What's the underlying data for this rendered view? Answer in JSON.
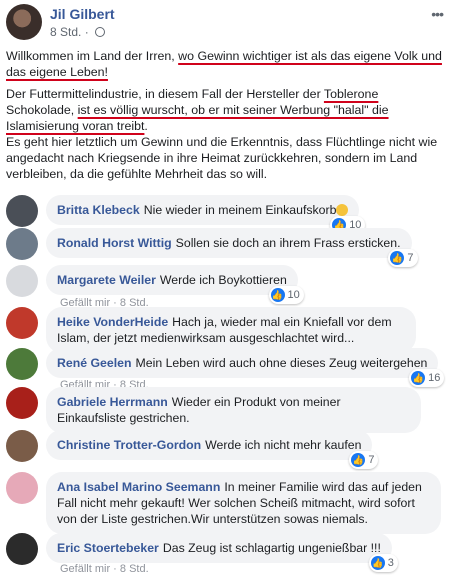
{
  "post": {
    "author": "Jil Gilbert",
    "time": "8 Std.",
    "menu_label": "•••",
    "p1_a": "Willkommen im Land der Irren, ",
    "p1_b": "wo Gewinn wichtiger ist als das eigene Volk und das eigene Leben!",
    "p2_a": "Der Futtermittelindustrie, in diesem Fall der Hersteller der ",
    "p2_b": "Toblerone",
    "p2_c": " Schokolade, ",
    "p2_d": "ist es völlig wurscht, ob er mit seiner Werbung \"halal\" die Islamisierung voran treibt",
    "p2_e": ".",
    "p3": "Es geht hier letztlich um Gewinn und die Erkenntnis, dass Flüchtlinge nicht wie angedacht nach Kriegsende in ihre Heimat zurückkehren, sondern im Land verbleiben, da die gefühlte Mehrheit das so will."
  },
  "comments": [
    {
      "name": "Britta Klebeck",
      "text": "Nie wieder in meinem Einkaufskorb",
      "likes": "10",
      "meta": ""
    },
    {
      "name": "Ronald Horst Wittig",
      "text": "Sollen sie doch an ihrem Frass ersticken.",
      "likes": "7",
      "meta": ""
    },
    {
      "name": "Margarete Weiler",
      "text": "Werde ich Boykottieren",
      "likes": "10",
      "meta": "Gefällt mir · 8 Std."
    },
    {
      "name": "Heike VonderHeide",
      "text": "Hach ja, wieder mal ein Kniefall vor dem Islam, der jetzt medienwirksam ausgeschlachtet wird...",
      "likes": "",
      "meta": ""
    },
    {
      "name": "René Geelen",
      "text": "Mein Leben wird auch ohne dieses Zeug weitergehen",
      "likes": "16",
      "meta": "Gefällt mir · 8 Std."
    },
    {
      "name": "Gabriele Herrmann",
      "text": "Wieder ein Produkt von meiner Einkaufsliste gestrichen.",
      "likes": "",
      "meta": ""
    },
    {
      "name": "Christine Trotter-Gordon",
      "text": "Werde ich nicht mehr kaufen",
      "likes": "7",
      "meta": ""
    },
    {
      "name": "Ana Isabel Marino Seemann",
      "text": "In meiner Familie wird das auf jeden Fall nicht mehr gekauft! Wer solchen Scheiß mitmacht, wird sofort von der Liste gestrichen.Wir unterstützen sowas niemals.",
      "likes": "",
      "meta": ""
    },
    {
      "name": "Eric Stoertebeker",
      "text": "Das Zeug ist schlagartig ungenießbar !!!",
      "likes": "3",
      "meta": "Gefällt mir · 8 Std."
    }
  ],
  "colors": {
    "name": "#385898",
    "bubble": "#f2f3f5",
    "underline": "#d0021b",
    "like": "#1877f2"
  },
  "icons": {
    "like": "thumbs-up-icon",
    "privacy": "globe-icon",
    "menu": "more-icon"
  }
}
